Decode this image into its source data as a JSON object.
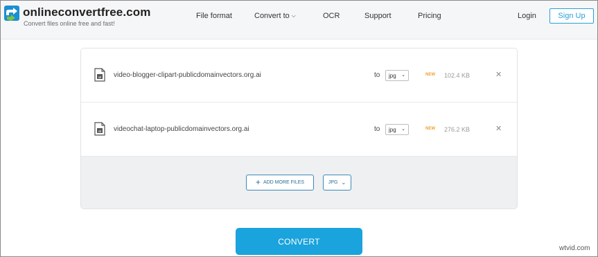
{
  "header": {
    "brand": "onlineconvertfree.com",
    "tagline": "Convert files online free and fast!",
    "nav": {
      "file_format": "File format",
      "convert_to": "Convert to",
      "ocr": "OCR",
      "support": "Support",
      "pricing": "Pricing",
      "login": "Login",
      "signup": "Sign Up"
    }
  },
  "files": [
    {
      "icon_label": "ai",
      "name": "video-blogger-clipart-publicdomainvectors.org.ai",
      "to_label": "to",
      "target_format": "jpg",
      "badge": "NEW",
      "size": "102.4 KB"
    },
    {
      "icon_label": "ai",
      "name": "videochat-laptop-publicdomainvectors.org.ai",
      "to_label": "to",
      "target_format": "jpg",
      "badge": "NEW",
      "size": "276.2 KB"
    }
  ],
  "actions": {
    "add_more_files": "ADD MORE FILES",
    "all_format": "JPG",
    "convert": "CONVERT"
  },
  "watermark": "wtvid.com",
  "colors": {
    "accent": "#1aa3dc",
    "signup_border": "#2a9fd6",
    "new_badge": "#f0a030",
    "logo_green": "#7cc243",
    "logo_blue": "#1b8fd1"
  },
  "icons": {
    "logo": "logo-arrows-icon",
    "file": "file-ai-icon",
    "remove": "close-icon",
    "add": "plus-icon",
    "caret": "chevron-down-icon"
  }
}
